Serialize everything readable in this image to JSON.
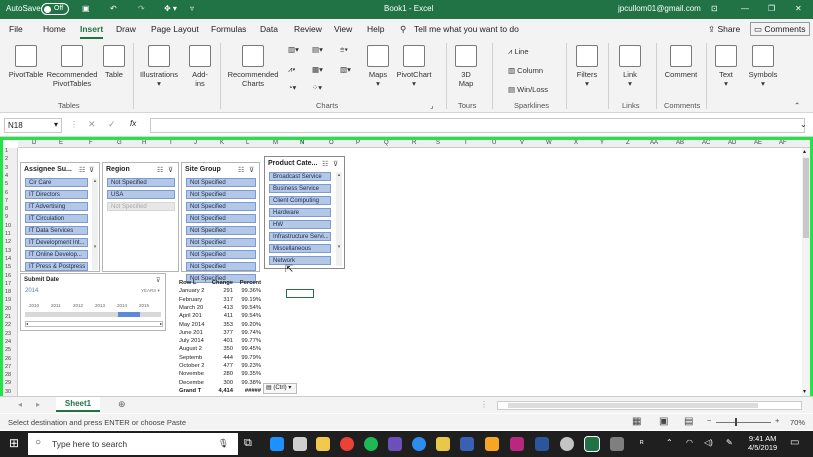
{
  "titlebar": {
    "autosave": "AutoSave",
    "autosave_state": "Off",
    "title": "Book1  -  Excel",
    "user": "jpcullom01@gmail.com"
  },
  "menu": {
    "tabs": [
      "File",
      "Home",
      "Insert",
      "Draw",
      "Page Layout",
      "Formulas",
      "Data",
      "Review",
      "View",
      "Help"
    ],
    "active": "Insert",
    "tell_me": "Tell me what you want to do",
    "share": "Share",
    "comments": "Comments"
  },
  "ribbon": {
    "pivottable": "PivotTable",
    "recommended_pivot": "Recommended\nPivotTables",
    "table": "Table",
    "illustrations": "Illustrations",
    "addins": "Add-\nins",
    "recommended_charts": "Recommended\nCharts",
    "maps": "Maps",
    "pivotchart": "PivotChart",
    "map3d": "3D\nMap",
    "line": "Line",
    "column": "Column",
    "winloss": "Win/Loss",
    "filters": "Filters",
    "link": "Link",
    "comment": "Comment",
    "text": "Text",
    "symbols": "Symbols",
    "groups": {
      "tables": "Tables",
      "charts": "Charts",
      "tours": "Tours",
      "sparklines": "Sparklines",
      "links": "Links",
      "comments": "Comments"
    }
  },
  "formula": {
    "name_box": "N18",
    "fx": "fx",
    "value": ""
  },
  "columns": [
    "D",
    "E",
    "F",
    "G",
    "H",
    "I",
    "J",
    "K",
    "L",
    "M",
    "N",
    "O",
    "P",
    "Q",
    "R",
    "S",
    "T",
    "U",
    "V",
    "W",
    "X",
    "Y",
    "Z",
    "AA",
    "AB",
    "AC",
    "AD",
    "AE",
    "AF"
  ],
  "rows": [
    "1",
    "2",
    "3",
    "4",
    "5",
    "6",
    "7",
    "8",
    "9",
    "10",
    "11",
    "12",
    "13",
    "14",
    "15",
    "16",
    "17",
    "18",
    "19",
    "20",
    "21",
    "22",
    "23",
    "24",
    "25",
    "26",
    "27",
    "28",
    "29",
    "30"
  ],
  "slicers": {
    "assignee": {
      "title": "Assignee Su...",
      "items": [
        "Cir Care",
        "IT Directors",
        "IT Advertising",
        "IT Circulation",
        "IT Data Services",
        "IT Development Int...",
        "IT Online Develop...",
        "IT Press & Postpress"
      ]
    },
    "region": {
      "title": "Region",
      "items": [
        "Not Specified",
        "USA",
        "Not Specified"
      ]
    },
    "site": {
      "title": "Site Group",
      "items": [
        "Not Specified",
        "Not Specified",
        "Not Specified",
        "Not Specified",
        "Not Specified",
        "Not Specified",
        "Not Specified",
        "Not Specified",
        "Not Specified"
      ]
    },
    "product": {
      "title": "Product Cate...",
      "items": [
        "Broadcast Service",
        "Business Service",
        "Client Computing",
        "Hardware",
        "HW",
        "Infrastructure Servi...",
        "Miscellaneous",
        "Network"
      ]
    }
  },
  "timeline": {
    "title": "Submit Date",
    "year": "2014",
    "level": "YEARS",
    "years": [
      "2010",
      "2011",
      "2012",
      "2013",
      "2014",
      "2015"
    ]
  },
  "pivot": {
    "headers": [
      "Row L",
      "Change",
      "Percent"
    ],
    "rows": [
      [
        "January 2",
        "291",
        "99.36%"
      ],
      [
        "February",
        "317",
        "99.19%"
      ],
      [
        "March 20",
        "413",
        "99.54%"
      ],
      [
        "April 201",
        "411",
        "99.54%"
      ],
      [
        "May 2014",
        "353",
        "99.20%"
      ],
      [
        "June 201",
        "377",
        "99.74%"
      ],
      [
        "July 2014",
        "401",
        "99.77%"
      ],
      [
        "August 2",
        "350",
        "99.45%"
      ],
      [
        "Septemb",
        "444",
        "99.79%"
      ],
      [
        "October 2",
        "477",
        "99.23%"
      ],
      [
        "Novembe",
        "280",
        "99.35%"
      ],
      [
        "Decembe",
        "300",
        "99.38%"
      ]
    ],
    "total": [
      "Grand T",
      "4,414",
      "#####"
    ]
  },
  "paste_ctrl": "(Ctrl)",
  "sheet": {
    "tab": "Sheet1"
  },
  "status": {
    "message": "Select destination and press ENTER or choose Paste",
    "zoom": "70%"
  },
  "taskbar": {
    "search": "Type here to search",
    "time": "9:41 AM",
    "date": "4/5/2019"
  },
  "colors": {
    "excel_green": "#217346",
    "highlight": "#22e34a",
    "slicer_item": "#b4c7e7"
  }
}
